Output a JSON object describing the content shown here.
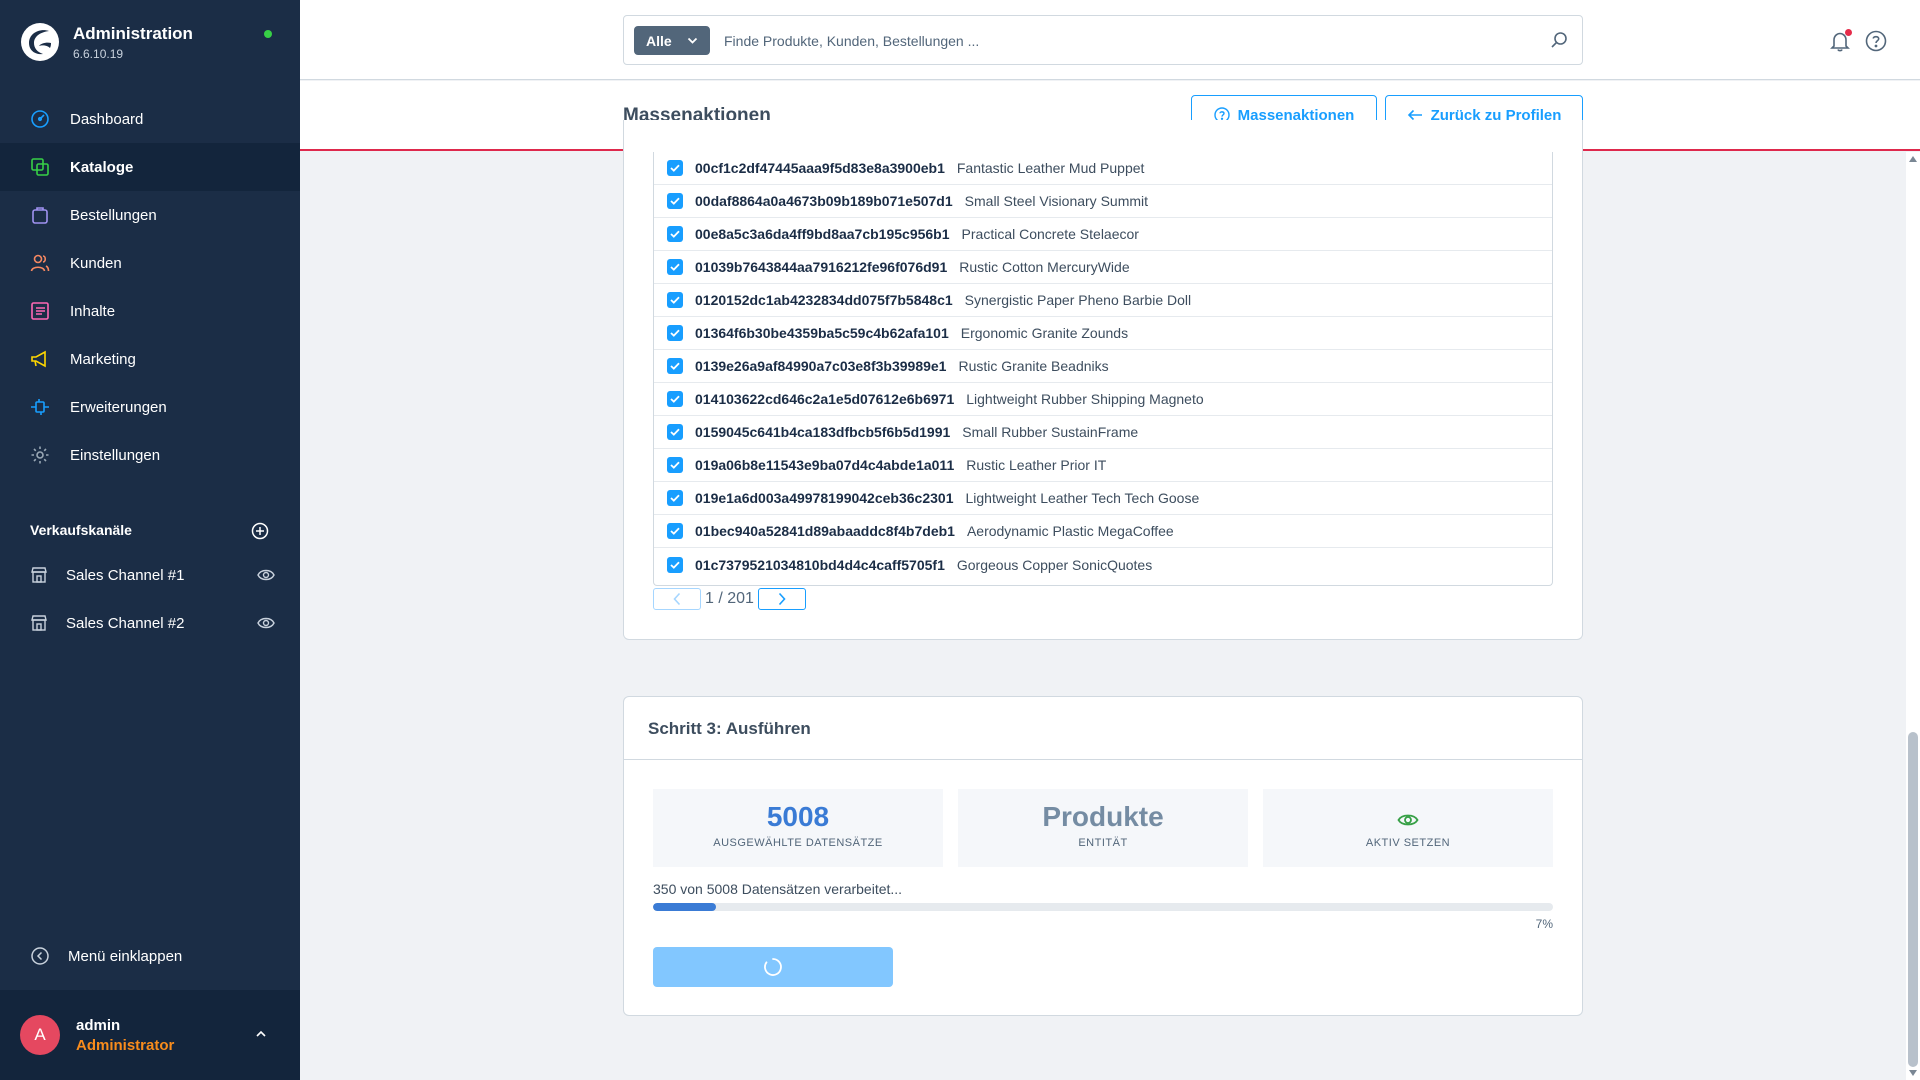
{
  "app": {
    "title": "Administration",
    "version": "6.6.10.19"
  },
  "nav": {
    "items": [
      {
        "label": "Dashboard",
        "icon": "gauge-icon"
      },
      {
        "label": "Kataloge",
        "icon": "catalog-icon",
        "active": true
      },
      {
        "label": "Bestellungen",
        "icon": "shopping-bag-icon"
      },
      {
        "label": "Kunden",
        "icon": "users-icon"
      },
      {
        "label": "Inhalte",
        "icon": "content-icon"
      },
      {
        "label": "Marketing",
        "icon": "megaphone-icon"
      },
      {
        "label": "Erweiterungen",
        "icon": "plug-icon"
      },
      {
        "label": "Einstellungen",
        "icon": "gear-icon"
      }
    ]
  },
  "sales_channels": {
    "title": "Verkaufskanäle",
    "items": [
      {
        "label": "Sales Channel #1"
      },
      {
        "label": "Sales Channel #2"
      }
    ]
  },
  "collapse_label": "Menü einklappen",
  "user": {
    "initial": "A",
    "name": "admin",
    "role": "Administrator"
  },
  "search": {
    "type": "Alle",
    "placeholder": "Finde Produkte, Kunden, Bestellungen ..."
  },
  "page": {
    "title": "Massenaktionen",
    "help_button": "Massenaktionen",
    "back_button": "Zurück zu Profilen"
  },
  "records": [
    {
      "id": "00cf1c2df47445aaa9f5d83e8a3900eb1",
      "name": "Fantastic Leather Mud Puppet"
    },
    {
      "id": "00daf8864a0a4673b09b189b071e507d1",
      "name": "Small Steel Visionary Summit"
    },
    {
      "id": "00e8a5c3a6da4ff9bd8aa7cb195c956b1",
      "name": "Practical Concrete Stelaecor"
    },
    {
      "id": "01039b7643844aa7916212fe96f076d91",
      "name": "Rustic Cotton MercuryWide"
    },
    {
      "id": "0120152dc1ab4232834dd075f7b5848c1",
      "name": "Synergistic Paper Pheno Barbie Doll"
    },
    {
      "id": "01364f6b30be4359ba5c59c4b62afa101",
      "name": "Ergonomic Granite Zounds"
    },
    {
      "id": "0139e26a9af84990a7c03e8f3b39989e1",
      "name": "Rustic Granite Beadniks"
    },
    {
      "id": "014103622cd646c2a1e5d07612e6b6971",
      "name": "Lightweight Rubber Shipping Magneto"
    },
    {
      "id": "0159045c641b4ca183dfbcb5f6b5d1991",
      "name": "Small Rubber SustainFrame"
    },
    {
      "id": "019a06b8e11543e9ba07d4c4abde1a011",
      "name": "Rustic Leather Prior IT"
    },
    {
      "id": "019e1a6d003a49978199042ceb36c2301",
      "name": "Lightweight Leather Tech Tech Goose"
    },
    {
      "id": "01bec940a52841d89abaaddc8f4b7deb1",
      "name": "Aerodynamic Plastic MegaCoffee"
    },
    {
      "id": "01c7379521034810bd4d4c4caff5705f1",
      "name": "Gorgeous Copper SonicQuotes"
    }
  ],
  "pager": {
    "text": "1 / 201"
  },
  "step3": {
    "title": "Schritt 3: Ausführen",
    "stats": [
      {
        "value": "5008",
        "label": "AUSGEWÄHLTE DATENSÄTZE"
      },
      {
        "value": "Produkte",
        "label": "ENTITÄT"
      },
      {
        "value": "",
        "label": "AKTIV SETZEN",
        "icon": "eye-icon"
      }
    ],
    "progress_text": "350 von 5008 Datensätzen verarbeitet...",
    "progress_fraction": 0.07,
    "progress_label": "7%"
  },
  "colors": {
    "sidebar": "#1b2d46",
    "accent": "#189eff",
    "stat_blue": "#3a7bd5",
    "stat_grey": "#758ca3",
    "success": "#37d046",
    "alert": "#de294c"
  }
}
